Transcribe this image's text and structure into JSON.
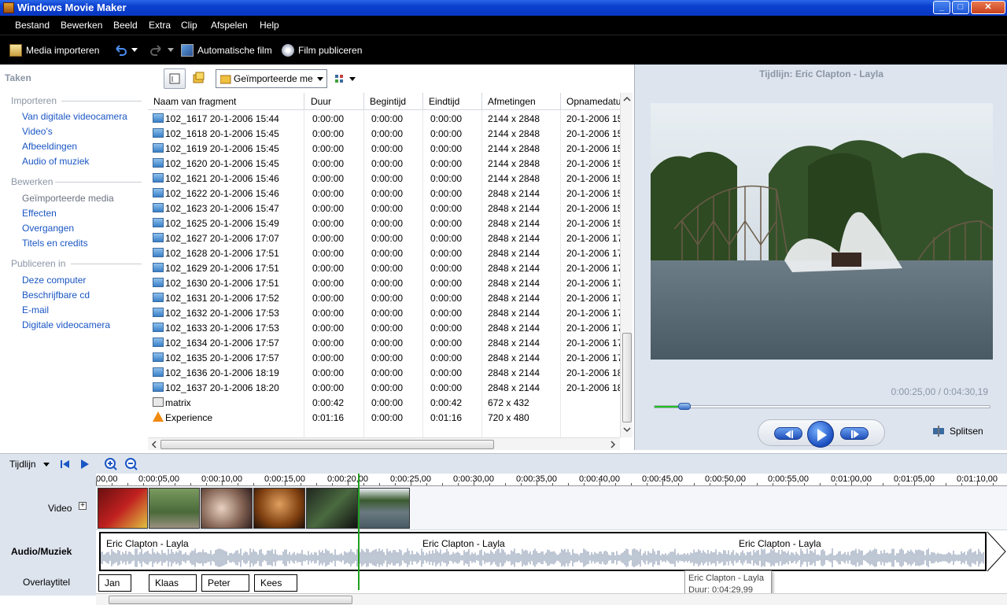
{
  "window": {
    "title": "Windows Movie Maker"
  },
  "menu": [
    "Bestand",
    "Bewerken",
    "Beeld",
    "Extra",
    "Clip",
    "Afspelen",
    "Help"
  ],
  "toolbar": {
    "import_label": "Media importeren",
    "automovie_label": "Automatische film",
    "publish_label": "Film publiceren"
  },
  "tasks": {
    "header": "Taken",
    "sections": [
      {
        "title": "Importeren",
        "items": [
          "Van digitale videocamera",
          "Video's",
          "Afbeeldingen",
          "Audio of muziek"
        ]
      },
      {
        "title": "Bewerken",
        "items": [
          "Geïmporteerde media",
          "Effecten",
          "Overgangen",
          "Titels en credits"
        ]
      },
      {
        "title": "Publiceren in",
        "items": [
          "Deze computer",
          "Beschrijfbare cd",
          "E-mail",
          "Digitale videocamera"
        ]
      }
    ]
  },
  "collection": {
    "selected": "Geïmporteerde me"
  },
  "table": {
    "columns": [
      "Naam van fragment",
      "Duur",
      "Begintijd",
      "Eindtijd",
      "Afmetingen",
      "Opnamedatu"
    ],
    "rows": [
      [
        "102_1617 20-1-2006 15:44",
        "0:00:00",
        "0:00:00",
        "0:00:00",
        "2144 x 2848",
        "20-1-2006 15"
      ],
      [
        "102_1618 20-1-2006 15:45",
        "0:00:00",
        "0:00:00",
        "0:00:00",
        "2144 x 2848",
        "20-1-2006 15"
      ],
      [
        "102_1619 20-1-2006 15:45",
        "0:00:00",
        "0:00:00",
        "0:00:00",
        "2144 x 2848",
        "20-1-2006 15"
      ],
      [
        "102_1620 20-1-2006 15:45",
        "0:00:00",
        "0:00:00",
        "0:00:00",
        "2144 x 2848",
        "20-1-2006 15"
      ],
      [
        "102_1621 20-1-2006 15:46",
        "0:00:00",
        "0:00:00",
        "0:00:00",
        "2144 x 2848",
        "20-1-2006 15"
      ],
      [
        "102_1622 20-1-2006 15:46",
        "0:00:00",
        "0:00:00",
        "0:00:00",
        "2848 x 2144",
        "20-1-2006 15"
      ],
      [
        "102_1623 20-1-2006 15:47",
        "0:00:00",
        "0:00:00",
        "0:00:00",
        "2848 x 2144",
        "20-1-2006 15"
      ],
      [
        "102_1625 20-1-2006 15:49",
        "0:00:00",
        "0:00:00",
        "0:00:00",
        "2848 x 2144",
        "20-1-2006 15"
      ],
      [
        "102_1627 20-1-2006 17:07",
        "0:00:00",
        "0:00:00",
        "0:00:00",
        "2848 x 2144",
        "20-1-2006 17"
      ],
      [
        "102_1628 20-1-2006 17:51",
        "0:00:00",
        "0:00:00",
        "0:00:00",
        "2848 x 2144",
        "20-1-2006 17"
      ],
      [
        "102_1629 20-1-2006 17:51",
        "0:00:00",
        "0:00:00",
        "0:00:00",
        "2848 x 2144",
        "20-1-2006 17"
      ],
      [
        "102_1630 20-1-2006 17:51",
        "0:00:00",
        "0:00:00",
        "0:00:00",
        "2848 x 2144",
        "20-1-2006 17"
      ],
      [
        "102_1631 20-1-2006 17:52",
        "0:00:00",
        "0:00:00",
        "0:00:00",
        "2848 x 2144",
        "20-1-2006 17"
      ],
      [
        "102_1632 20-1-2006 17:53",
        "0:00:00",
        "0:00:00",
        "0:00:00",
        "2848 x 2144",
        "20-1-2006 17"
      ],
      [
        "102_1633 20-1-2006 17:53",
        "0:00:00",
        "0:00:00",
        "0:00:00",
        "2848 x 2144",
        "20-1-2006 17"
      ],
      [
        "102_1634 20-1-2006 17:57",
        "0:00:00",
        "0:00:00",
        "0:00:00",
        "2848 x 2144",
        "20-1-2006 17"
      ],
      [
        "102_1635 20-1-2006 17:57",
        "0:00:00",
        "0:00:00",
        "0:00:00",
        "2848 x 2144",
        "20-1-2006 17"
      ],
      [
        "102_1636 20-1-2006 18:19",
        "0:00:00",
        "0:00:00",
        "0:00:00",
        "2848 x 2144",
        "20-1-2006 18"
      ],
      [
        "102_1637 20-1-2006 18:20",
        "0:00:00",
        "0:00:00",
        "0:00:00",
        "2848 x 2144",
        "20-1-2006 18"
      ],
      [
        "matrix",
        "0:00:42",
        "0:00:00",
        "0:00:42",
        "672 x 432",
        ""
      ],
      [
        "Experience",
        "0:01:16",
        "0:00:00",
        "0:01:16",
        "720 x 480",
        ""
      ]
    ],
    "row_icons": [
      "image-icon",
      "image-icon",
      "image-icon",
      "image-icon",
      "image-icon",
      "image-icon",
      "image-icon",
      "image-icon",
      "image-icon",
      "image-icon",
      "image-icon",
      "image-icon",
      "image-icon",
      "image-icon",
      "image-icon",
      "image-icon",
      "image-icon",
      "image-icon",
      "image-icon",
      "video-file-icon",
      "vlc-cone-icon"
    ]
  },
  "preview": {
    "title": "Tijdlijn: Eric Clapton - Layla",
    "time": "0:00:25,00 / 0:04:30,19",
    "progress_fraction": 0.09,
    "split_label": "Splitsen"
  },
  "timeline": {
    "label": "Tijdlijn",
    "ruler": [
      "00,00",
      "0:00:05,00",
      "0:00:10,00",
      "0:00:15,00",
      "0:00:20,00",
      "0:00:25,00",
      "0:00:30,00",
      "0:00:35,00",
      "0:00:40,00",
      "0:00:45,00",
      "0:00:50,00",
      "0:00:55,00",
      "0:01:00,00",
      "0:01:05,00",
      "0:01:10,00"
    ],
    "tracks": {
      "video": "Video",
      "audio": "Audio/Muziek",
      "overlay": "Overlaytitel"
    },
    "audio_labels": [
      "Eric Clapton - Layla",
      "Eric Clapton - Layla",
      "Eric Clapton - Layla"
    ],
    "overlay_titles": [
      "Jan",
      "Klaas",
      "Peter",
      "Kees"
    ],
    "tooltip": {
      "title": "Eric Clapton - Layla",
      "duration": "Duur:  0:04:29,99"
    }
  },
  "colors": {
    "accent": "#1a56c4",
    "titlebar": "#0a3fce",
    "playhead": "#20a020"
  }
}
